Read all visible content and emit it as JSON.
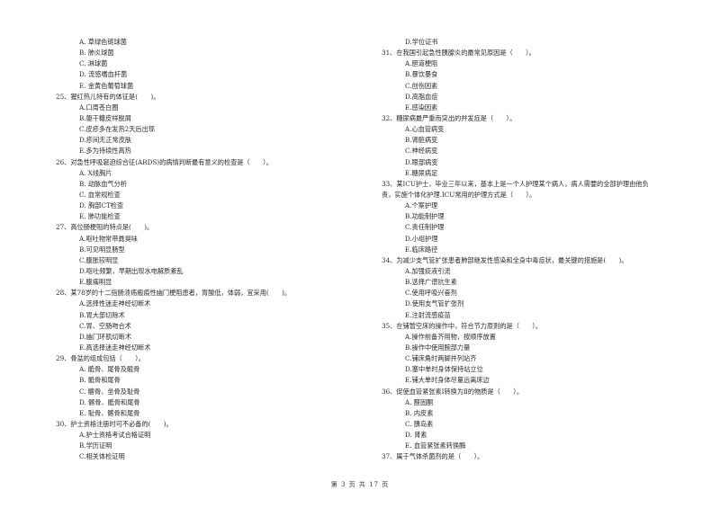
{
  "left_column": [
    {
      "type": "opt",
      "text": "A. 草绿色链球菌"
    },
    {
      "type": "opt",
      "text": "B. 肺炎球菌"
    },
    {
      "type": "opt",
      "text": "C. 淋球菌"
    },
    {
      "type": "opt",
      "text": "D. 流感嗜血杆菌"
    },
    {
      "type": "opt",
      "text": "E. 金黄色葡萄球菌"
    },
    {
      "type": "q",
      "text": "25、猩红热儿特有的体征是(　　)。"
    },
    {
      "type": "opt",
      "text": "A.口周苍白圈"
    },
    {
      "type": "opt",
      "text": "B.躯干糠皮样脱屑"
    },
    {
      "type": "opt",
      "text": "C.皮疹多在发热2天后出现"
    },
    {
      "type": "opt",
      "text": "D.疹间无正常皮肤"
    },
    {
      "type": "opt",
      "text": "E.多为持续性高热"
    },
    {
      "type": "q",
      "text": "26、对急性呼吸窘迫综合征(ARDS)的病情判断最有意义的检查是（　　）。"
    },
    {
      "type": "opt",
      "text": "A. X线胸片"
    },
    {
      "type": "opt",
      "text": "B. 动脉血气分析"
    },
    {
      "type": "opt",
      "text": "C. 血常规检查"
    },
    {
      "type": "opt",
      "text": "D. 胸部CT检查"
    },
    {
      "type": "opt",
      "text": "E. 肺功能检查"
    },
    {
      "type": "q",
      "text": "27、高位肠梗阻的特点是(　　)。"
    },
    {
      "type": "opt",
      "text": "A.呕吐物常带粪臭味"
    },
    {
      "type": "opt",
      "text": "B.可见明显肠型"
    },
    {
      "type": "opt",
      "text": "C.腹胀较明显"
    },
    {
      "type": "opt",
      "text": "D.呕吐频繁，早期出现水电解质紊乱"
    },
    {
      "type": "opt",
      "text": "E.腹痛明显"
    },
    {
      "type": "q",
      "text": "28、某78岁的十二指肠溃疡瘢痕性幽门梗阻患者，胃酸低，体弱，宜采用(　　)。"
    },
    {
      "type": "opt",
      "text": "A.选择性迷走神经切断术"
    },
    {
      "type": "opt",
      "text": "B.胃大部切除术"
    },
    {
      "type": "opt",
      "text": "C.胃、空肠吻合术"
    },
    {
      "type": "opt",
      "text": "D.幽门环肌切断术"
    },
    {
      "type": "opt",
      "text": "E.高选择迷走神经切断术"
    },
    {
      "type": "q",
      "text": "29、骨盆的组成包括（　　）。"
    },
    {
      "type": "opt",
      "text": "A. 骶骨、尾骨及髋骨"
    },
    {
      "type": "opt",
      "text": "B. 骶骨和尾骨"
    },
    {
      "type": "opt",
      "text": "C. 髂骨、坐骨及耻骨"
    },
    {
      "type": "opt",
      "text": "D. 髂骨、骶骨和尾骨"
    },
    {
      "type": "opt",
      "text": "E. 耻骨、髂骨和尾骨"
    },
    {
      "type": "q",
      "text": "30、护士资格注册时可不必备的(　　)。"
    },
    {
      "type": "opt",
      "text": "A.护士资格考试合格证明"
    },
    {
      "type": "opt",
      "text": "B.学历证明"
    },
    {
      "type": "opt",
      "text": "C.相关体检证明"
    }
  ],
  "right_column": [
    {
      "type": "opt",
      "text": "D.学位证书"
    },
    {
      "type": "q",
      "text": "31、在我国引起急性胰腺炎的最常见原因是（　　）。"
    },
    {
      "type": "opt",
      "text": "A.胆道梗阻"
    },
    {
      "type": "opt",
      "text": "B.暴饮暴食"
    },
    {
      "type": "opt",
      "text": "C.创伤因素"
    },
    {
      "type": "opt",
      "text": "D.高脂血症"
    },
    {
      "type": "opt",
      "text": "E.感染因素"
    },
    {
      "type": "q",
      "text": "32、糖尿病最严重而突出的并发症是（　　）。"
    },
    {
      "type": "opt",
      "text": "A.心血管病变"
    },
    {
      "type": "opt",
      "text": "B.肾脏病变"
    },
    {
      "type": "opt",
      "text": "C.神经病变"
    },
    {
      "type": "opt",
      "text": "D.眼部病变"
    },
    {
      "type": "opt",
      "text": "E.糖尿病足"
    },
    {
      "type": "q",
      "text": "33、某ICU护士，毕业三年以来，基本上是一个人护理某个病人，病人需要的全部护理由他负"
    },
    {
      "type": "q",
      "text": "责，实施个体化护理.ICU常用的护理方式是（　　）。"
    },
    {
      "type": "opt",
      "text": "A.个案护理"
    },
    {
      "type": "opt",
      "text": "B.功能制护理"
    },
    {
      "type": "opt",
      "text": "C.责任制护理"
    },
    {
      "type": "opt",
      "text": "D.小组护理"
    },
    {
      "type": "opt",
      "text": "E.临床路径"
    },
    {
      "type": "q",
      "text": "34、为减少支气管扩张患者肺部继发性感染和全身中毒症状，最关键的措施是(　　)。"
    },
    {
      "type": "opt",
      "text": "A.加强痰液引流"
    },
    {
      "type": "opt",
      "text": "B.选择广谱抗生素"
    },
    {
      "type": "opt",
      "text": "C.使用呼吸兴奋剂"
    },
    {
      "type": "opt",
      "text": "D.使用支气管扩张剂"
    },
    {
      "type": "opt",
      "text": "E.注射流感疫苗"
    },
    {
      "type": "q",
      "text": "35、在铺暂空床的操作中，符合节力原则的是（　　）。"
    },
    {
      "type": "opt",
      "text": "A.操作前备齐用物，按顺序放置"
    },
    {
      "type": "opt",
      "text": "B.操作中使用腕部力量"
    },
    {
      "type": "opt",
      "text": "C.铺床角时两脚并列站齐"
    },
    {
      "type": "opt",
      "text": "D.塞中单时身体保持站立位"
    },
    {
      "type": "opt",
      "text": "E.铺大单时身体尽量远离床边"
    },
    {
      "type": "q",
      "text": "36、促使血管紧张素Ⅰ转换为Ⅱ的物质是（　　）。"
    },
    {
      "type": "opt",
      "text": "A. 醛固酮"
    },
    {
      "type": "opt",
      "text": "B. 内皮素"
    },
    {
      "type": "opt",
      "text": "C. 胰岛素"
    },
    {
      "type": "opt",
      "text": "D. 肾素"
    },
    {
      "type": "opt",
      "text": "E. 血管紧张素转换酶"
    },
    {
      "type": "q",
      "text": "37、属于气体杀菌剂的是（　　）。"
    }
  ],
  "footer": {
    "page_label": "第 3 页 共 17 页"
  }
}
